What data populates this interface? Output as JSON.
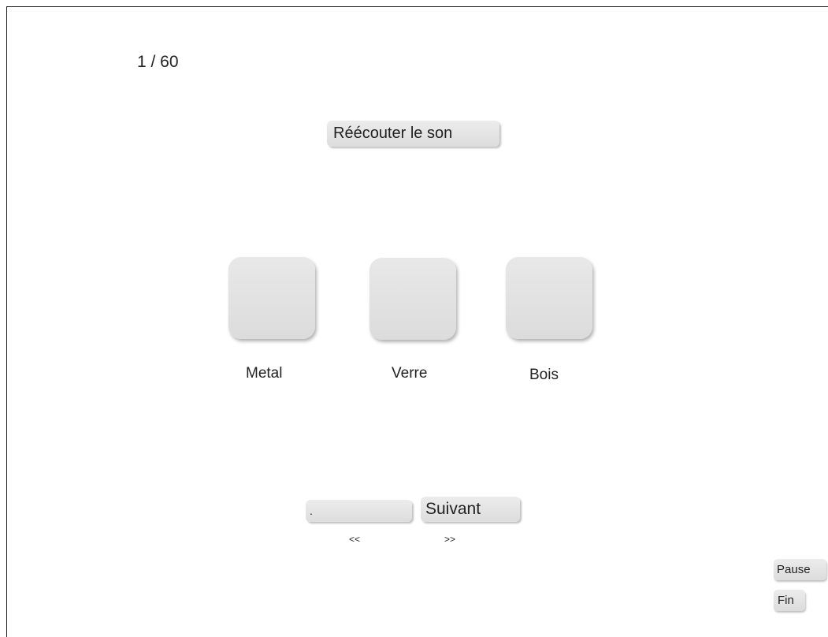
{
  "progress": {
    "counter_text": "1 / 60"
  },
  "replay": {
    "label": "Réécouter le son"
  },
  "choices": [
    {
      "label": "Metal"
    },
    {
      "label": "Verre"
    },
    {
      "label": "Bois"
    }
  ],
  "navigation": {
    "prev_label": ".",
    "next_label": "Suivant",
    "prev_arrow": "<<",
    "next_arrow": ">>"
  },
  "controls": {
    "pause_label": "Pause",
    "end_label": "Fin"
  }
}
